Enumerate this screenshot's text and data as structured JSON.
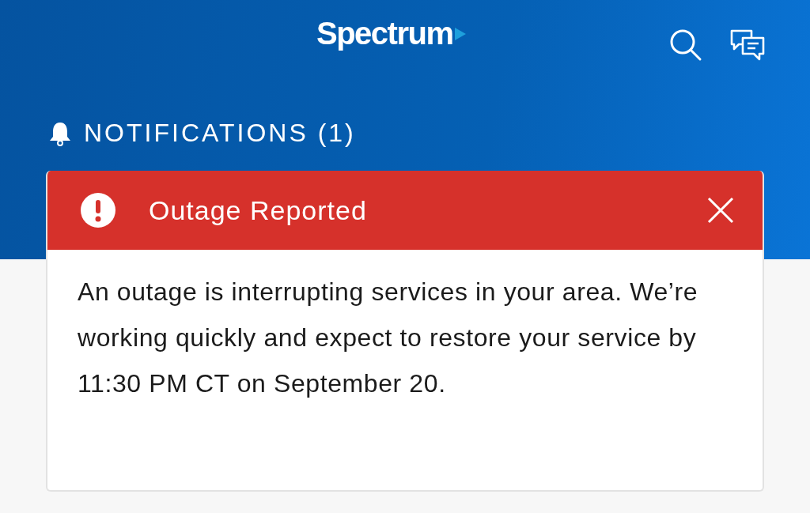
{
  "header": {
    "logo": "Spectrum"
  },
  "notifications": {
    "heading": "NOTIFICATIONS (1)"
  },
  "alert": {
    "title": "Outage Reported",
    "message": "An outage is interrupting services in your area. We’re working quickly and expect to restore your service by 11:30 PM CT on September 20."
  }
}
